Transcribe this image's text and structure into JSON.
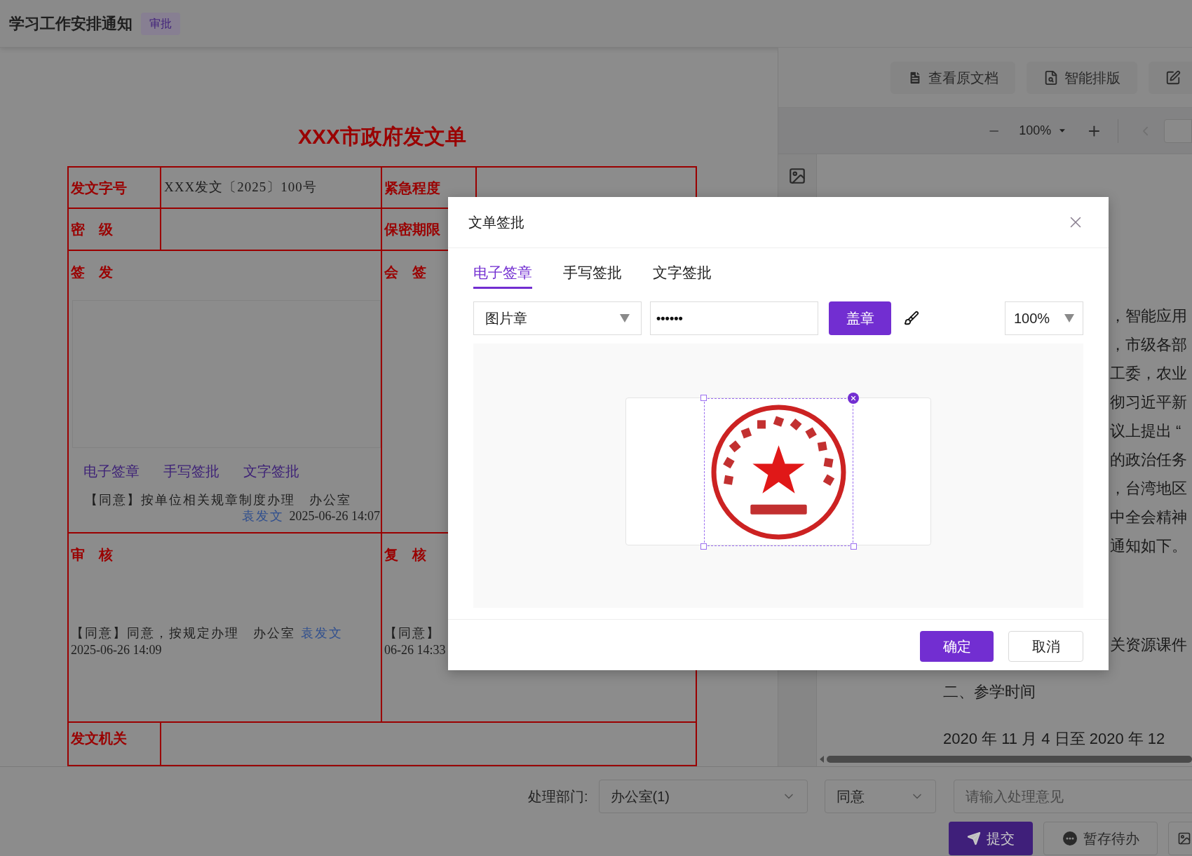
{
  "header": {
    "title": "学习工作安排通知",
    "badge": "审批"
  },
  "form": {
    "title": "XXX市政府发文单",
    "doc_number": {
      "label": "发文字号",
      "value": "XXX发文〔2025〕100号"
    },
    "urgency": {
      "label": "紧急程度"
    },
    "secret_level": {
      "label": "密　级"
    },
    "secret_period": {
      "label": "保密期限"
    },
    "sign": {
      "label": "签　发",
      "actions": [
        "电子签章",
        "手写签批",
        "文字签批"
      ],
      "opinion": "【同意】按单位相关规章制度办理　办公室",
      "signer": "袁发文",
      "time": "2025-06-26 14:07"
    },
    "countersign": {
      "label": "会　签"
    },
    "review": {
      "label": "审　核",
      "opinion": "【同意】同意，按规定办理　办公室",
      "signer": "袁发文",
      "time": "2025-06-26 14:09"
    },
    "recheck": {
      "label": "复　核",
      "opinion": "【同意】",
      "time": "06-26 14:33"
    },
    "issuer": {
      "label": "发文机关"
    }
  },
  "toolbar": {
    "buttons": [
      {
        "label": "查看原文档",
        "kind": "file"
      },
      {
        "label": "智能排版",
        "kind": "layout"
      },
      {
        "kind": "edit"
      }
    ],
    "zoom": "100%"
  },
  "document": {
    "fragments": [
      "，智能应用",
      "，市级各部",
      "工委，农业",
      "彻习近平新",
      "议上提出 “",
      "的政治任务",
      "，台湾地区",
      "中全会精神",
      "通知如下。",
      "关资源课件"
    ],
    "heading": "二、参学时间",
    "period": "2020 年 11 月 4 日至 2020 年 12"
  },
  "process": {
    "department_label": "处理部门:",
    "department": "办公室(1)",
    "decision": "同意",
    "opinion_placeholder": "请输入处理意见",
    "buttons": [
      {
        "label": "提交",
        "kind": "primary"
      },
      {
        "label": "暂存待办",
        "kind": "default"
      },
      {
        "kind": "icon"
      }
    ]
  },
  "modal": {
    "title": "文单签批",
    "tabs": [
      {
        "label": "电子签章",
        "selected": true
      },
      {
        "label": "手写签批",
        "selected": false
      },
      {
        "label": "文字签批",
        "selected": false
      }
    ],
    "seal_type": "图片章",
    "password_mask": "••••••",
    "stamp_button": "盖章",
    "zoom": "100%",
    "buttons": [
      {
        "label": "确定",
        "kind": "primary"
      },
      {
        "label": "取消",
        "kind": "default"
      }
    ]
  }
}
